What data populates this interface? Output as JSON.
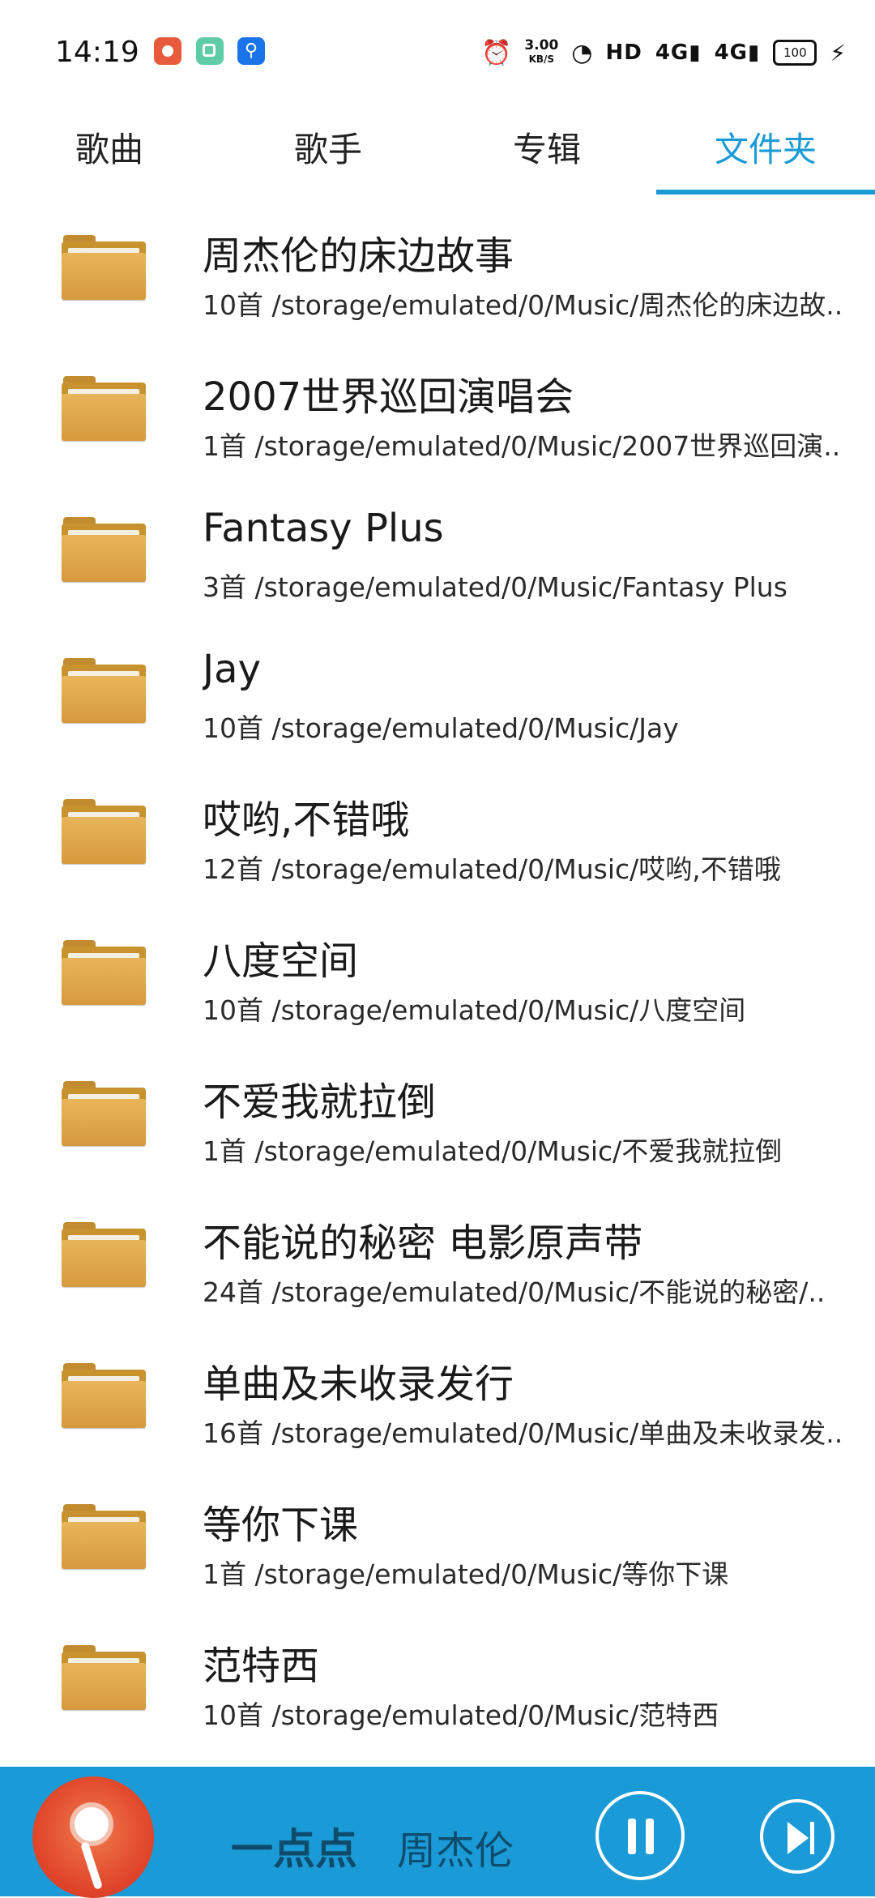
{
  "status_bar": {
    "time": "14:19",
    "speed_value": "3.00",
    "speed_unit": "KB/S",
    "network_hd": "HD",
    "signal1": "4G",
    "signal2": "4G",
    "battery": "100"
  },
  "tabs": [
    {
      "label": "歌曲",
      "active": false
    },
    {
      "label": "歌手",
      "active": false
    },
    {
      "label": "专辑",
      "active": false
    },
    {
      "label": "文件夹",
      "active": true
    }
  ],
  "folders": [
    {
      "name": "周杰伦的床边故事",
      "info": "10首 /storage/emulated/0/Music/周杰伦的床边故.."
    },
    {
      "name": "2007世界巡回演唱会",
      "info": "1首 /storage/emulated/0/Music/2007世界巡回演.."
    },
    {
      "name": "Fantasy Plus",
      "info": "3首 /storage/emulated/0/Music/Fantasy Plus"
    },
    {
      "name": "Jay",
      "info": "10首 /storage/emulated/0/Music/Jay"
    },
    {
      "name": "哎哟,不错哦",
      "info": "12首 /storage/emulated/0/Music/哎哟,不错哦"
    },
    {
      "name": "八度空间",
      "info": "10首 /storage/emulated/0/Music/八度空间"
    },
    {
      "name": "不爱我就拉倒",
      "info": "1首 /storage/emulated/0/Music/不爱我就拉倒"
    },
    {
      "name": "不能说的秘密 电影原声带",
      "info": "24首 /storage/emulated/0/Music/不能说的秘密/.."
    },
    {
      "name": "单曲及未收录发行",
      "info": "16首 /storage/emulated/0/Music/单曲及未收录发.."
    },
    {
      "name": "等你下课",
      "info": "1首 /storage/emulated/0/Music/等你下课"
    },
    {
      "name": "范特西",
      "info": "10首 /storage/emulated/0/Music/范特西"
    }
  ],
  "player": {
    "song": "一点点",
    "artist": "周杰伦",
    "accent_color": "#1a9bd7"
  }
}
